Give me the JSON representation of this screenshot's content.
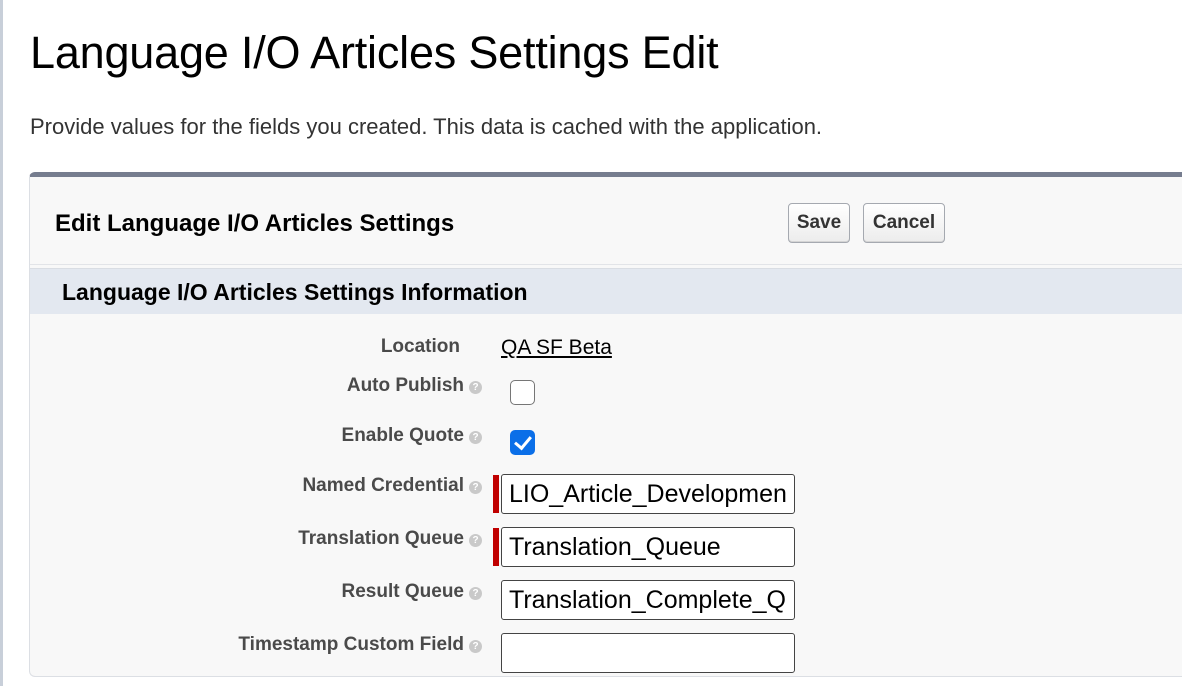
{
  "page": {
    "title": "Language I/O Articles Settings Edit",
    "description": "Provide values for the fields you created. This data is cached with the application."
  },
  "panel": {
    "title": "Edit Language I/O Articles Settings",
    "save_label": "Save",
    "cancel_label": "Cancel"
  },
  "section": {
    "title": "Language I/O Articles Settings Information"
  },
  "fields": {
    "location": {
      "label": "Location",
      "value": "QA SF Beta"
    },
    "auto_publish": {
      "label": "Auto Publish",
      "checked": false
    },
    "enable_quote": {
      "label": "Enable Quote",
      "checked": true
    },
    "named_credential": {
      "label": "Named Credential",
      "value": "LIO_Article_Development",
      "required": true
    },
    "translation_queue": {
      "label": "Translation Queue",
      "value": "Translation_Queue",
      "required": true
    },
    "result_queue": {
      "label": "Result Queue",
      "value": "Translation_Complete_Queue"
    },
    "timestamp_custom_field": {
      "label": "Timestamp Custom Field",
      "value": ""
    }
  },
  "help_icon_glyph": "?",
  "colors": {
    "panel_top_border": "#767d8f",
    "section_header_bg": "#e3e8f0",
    "required_marker": "#c00000",
    "checkbox_checked": "#0b6fe8"
  }
}
